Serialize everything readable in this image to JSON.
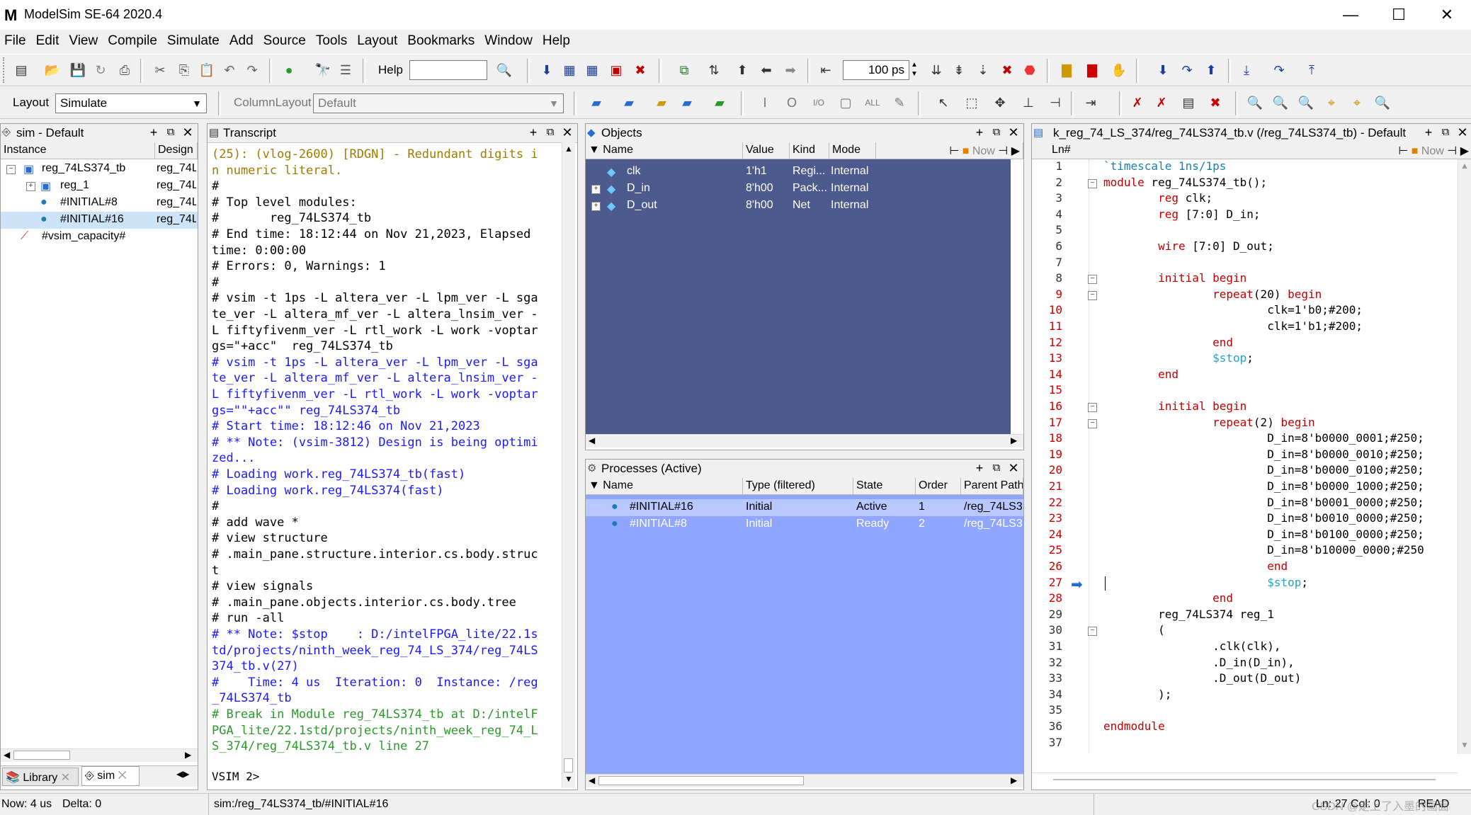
{
  "window": {
    "title": "ModelSim SE-64 2020.4",
    "minimize": "—",
    "maximize": "☐",
    "close": "✕"
  },
  "menu": [
    "File",
    "Edit",
    "View",
    "Compile",
    "Simulate",
    "Add",
    "Source",
    "Tools",
    "Layout",
    "Bookmarks",
    "Window",
    "Help"
  ],
  "toolbar": {
    "help_label": "Help",
    "help_value": "",
    "time_value": "100 ps",
    "layout_label": "Layout",
    "layout_value": "Simulate",
    "columnlayout_label": "ColumnLayout",
    "columnlayout_value": "Default"
  },
  "sim_pane": {
    "title": "sim - Default",
    "columns": [
      "Instance",
      "Design u"
    ],
    "rows": [
      {
        "instance": "reg_74LS374_tb",
        "design": "reg_74L",
        "expander": "−",
        "icon": "module-icon"
      },
      {
        "instance": "reg_1",
        "design": "reg_74L",
        "expander": "+",
        "icon": "module-icon"
      },
      {
        "instance": "#INITIAL#8",
        "design": "reg_74L",
        "expander": "",
        "icon": "process-icon"
      },
      {
        "instance": "#INITIAL#16",
        "design": "reg_74L",
        "expander": "",
        "icon": "process-icon"
      },
      {
        "instance": "#vsim_capacity#",
        "design": "",
        "expander": "",
        "icon": "capacity-icon"
      }
    ],
    "tabs": [
      {
        "label": "Library"
      },
      {
        "label": "sim"
      }
    ]
  },
  "transcript": {
    "title": "Transcript",
    "lines": [
      {
        "t": "(25): (vlog-2600) [RDGN] - Redundant digits i",
        "c": "olive"
      },
      {
        "t": "n numeric literal.",
        "c": "olive"
      },
      {
        "t": "#",
        "c": "black"
      },
      {
        "t": "# Top level modules:",
        "c": "black"
      },
      {
        "t": "#       reg_74LS374_tb",
        "c": "black"
      },
      {
        "t": "# End time: 18:12:44 on Nov 21,2023, Elapsed",
        "c": "black"
      },
      {
        "t": "time: 0:00:00",
        "c": "black"
      },
      {
        "t": "# Errors: 0, Warnings: 1",
        "c": "black"
      },
      {
        "t": "#",
        "c": "black"
      },
      {
        "t": "# vsim -t 1ps -L altera_ver -L lpm_ver -L sga",
        "c": "black"
      },
      {
        "t": "te_ver -L altera_mf_ver -L altera_lnsim_ver -",
        "c": "black"
      },
      {
        "t": "L fiftyfivenm_ver -L rtl_work -L work -voptar",
        "c": "black"
      },
      {
        "t": "gs=\"+acc\"  reg_74LS374_tb",
        "c": "black"
      },
      {
        "t": "# vsim -t 1ps -L altera_ver -L lpm_ver -L sga",
        "c": "blue"
      },
      {
        "t": "te_ver -L altera_mf_ver -L altera_lnsim_ver -",
        "c": "blue"
      },
      {
        "t": "L fiftyfivenm_ver -L rtl_work -L work -voptar",
        "c": "blue"
      },
      {
        "t": "gs=\"\"+acc\"\" reg_74LS374_tb",
        "c": "blue"
      },
      {
        "t": "# Start time: 18:12:46 on Nov 21,2023",
        "c": "blue"
      },
      {
        "t": "# ** Note: (vsim-3812) Design is being optimi",
        "c": "blue"
      },
      {
        "t": "zed...",
        "c": "blue"
      },
      {
        "t": "# Loading work.reg_74LS374_tb(fast)",
        "c": "blue"
      },
      {
        "t": "# Loading work.reg_74LS374(fast)",
        "c": "blue"
      },
      {
        "t": "#",
        "c": "black"
      },
      {
        "t": "# add wave *",
        "c": "black"
      },
      {
        "t": "# view structure",
        "c": "black"
      },
      {
        "t": "# .main_pane.structure.interior.cs.body.struc",
        "c": "black"
      },
      {
        "t": "t",
        "c": "black"
      },
      {
        "t": "# view signals",
        "c": "black"
      },
      {
        "t": "# .main_pane.objects.interior.cs.body.tree",
        "c": "black"
      },
      {
        "t": "# run -all",
        "c": "black"
      },
      {
        "t": "# ** Note: $stop    : D:/intelFPGA_lite/22.1s",
        "c": "blue"
      },
      {
        "t": "td/projects/ninth_week_reg_74_LS_374/reg_74LS",
        "c": "blue"
      },
      {
        "t": "374_tb.v(27)",
        "c": "blue"
      },
      {
        "t": "#    Time: 4 us  Iteration: 0  Instance: /reg",
        "c": "blue"
      },
      {
        "t": "_74LS374_tb",
        "c": "blue"
      },
      {
        "t": "# Break in Module reg_74LS374_tb at D:/intelF",
        "c": "green"
      },
      {
        "t": "PGA_lite/22.1std/projects/ninth_week_reg_74_L",
        "c": "green"
      },
      {
        "t": "S_374/reg_74LS374_tb.v line 27",
        "c": "green"
      }
    ],
    "prompt": "VSIM 2>"
  },
  "objects": {
    "title": "Objects",
    "columns": [
      "Name",
      "Value",
      "Kind",
      "Mode"
    ],
    "now_label": "Now",
    "rows": [
      {
        "name": "clk",
        "value": "1'h1",
        "kind": "Regi...",
        "mode": "Internal",
        "expander": ""
      },
      {
        "name": "D_in",
        "value": "8'h00",
        "kind": "Pack...",
        "mode": "Internal",
        "expander": "+"
      },
      {
        "name": "D_out",
        "value": "8'h00",
        "kind": "Net",
        "mode": "Internal",
        "expander": "+"
      }
    ]
  },
  "processes": {
    "title": "Processes (Active)",
    "columns": [
      "Name",
      "Type (filtered)",
      "State",
      "Order",
      "Parent Path"
    ],
    "rows": [
      {
        "name": "#INITIAL#16",
        "type": "Initial",
        "state": "Active",
        "order": "1",
        "parent": "/reg_74LS3"
      },
      {
        "name": "#INITIAL#8",
        "type": "Initial",
        "state": "Ready",
        "order": "2",
        "parent": "/reg_74LS3"
      }
    ]
  },
  "source": {
    "title": "k_reg_74_LS_374/reg_74LS374_tb.v (/reg_74LS374_tb) - Default",
    "ln_header": "Ln#",
    "now_label": "Now",
    "current_line": 27,
    "lines": [
      {
        "n": "1",
        "t": "`timescale 1ns/1ps",
        "fold": ""
      },
      {
        "n": "2",
        "t": "module reg_74LS374_tb();",
        "fold": "−"
      },
      {
        "n": "3",
        "t": "        reg clk;",
        "fold": ""
      },
      {
        "n": "4",
        "t": "        reg [7:0] D_in;",
        "fold": ""
      },
      {
        "n": "5",
        "t": "",
        "fold": ""
      },
      {
        "n": "6",
        "t": "        wire [7:0] D_out;",
        "fold": ""
      },
      {
        "n": "7",
        "t": "",
        "fold": ""
      },
      {
        "n": "8",
        "t": "        initial begin",
        "fold": "−"
      },
      {
        "n": "9",
        "t": "                repeat(20) begin",
        "fold": "−"
      },
      {
        "n": "10",
        "t": "                        clk=1'b0;#200;",
        "fold": ""
      },
      {
        "n": "11",
        "t": "                        clk=1'b1;#200;",
        "fold": ""
      },
      {
        "n": "12",
        "t": "                end",
        "fold": ""
      },
      {
        "n": "13",
        "t": "                $stop;",
        "fold": ""
      },
      {
        "n": "14",
        "t": "        end",
        "fold": ""
      },
      {
        "n": "15",
        "t": "",
        "fold": ""
      },
      {
        "n": "16",
        "t": "        initial begin",
        "fold": "−"
      },
      {
        "n": "17",
        "t": "                repeat(2) begin",
        "fold": "−"
      },
      {
        "n": "18",
        "t": "                        D_in=8'b0000_0001;#250;",
        "fold": ""
      },
      {
        "n": "19",
        "t": "                        D_in=8'b0000_0010;#250;",
        "fold": ""
      },
      {
        "n": "20",
        "t": "                        D_in=8'b0000_0100;#250;",
        "fold": ""
      },
      {
        "n": "21",
        "t": "                        D_in=8'b0000_1000;#250;",
        "fold": ""
      },
      {
        "n": "22",
        "t": "                        D_in=8'b0001_0000;#250;",
        "fold": ""
      },
      {
        "n": "23",
        "t": "                        D_in=8'b0010_0000;#250;",
        "fold": ""
      },
      {
        "n": "24",
        "t": "                        D_in=8'b0100_0000;#250;",
        "fold": ""
      },
      {
        "n": "25",
        "t": "                        D_in=8'b10000_0000;#250",
        "fold": ""
      },
      {
        "n": "26",
        "t": "                        end",
        "fold": ""
      },
      {
        "n": "27",
        "t": "                        $stop;",
        "fold": ""
      },
      {
        "n": "28",
        "t": "                end",
        "fold": ""
      },
      {
        "n": "29",
        "t": "        reg_74LS374 reg_1",
        "fold": ""
      },
      {
        "n": "30",
        "t": "        (",
        "fold": "−"
      },
      {
        "n": "31",
        "t": "                .clk(clk),",
        "fold": ""
      },
      {
        "n": "32",
        "t": "                .D_in(D_in),",
        "fold": ""
      },
      {
        "n": "33",
        "t": "                .D_out(D_out)",
        "fold": ""
      },
      {
        "n": "34",
        "t": "        );",
        "fold": ""
      },
      {
        "n": "35",
        "t": "",
        "fold": ""
      },
      {
        "n": "36",
        "t": "endmodule",
        "fold": ""
      },
      {
        "n": "37",
        "t": "",
        "fold": ""
      }
    ]
  },
  "status": {
    "now": "Now: 4 us",
    "delta": "Delta: 0",
    "path": "sim:/reg_74LS374_tb/#INITIAL#16",
    "ln": "Ln:",
    "ln_value": "27",
    "col": "Col:",
    "col_value": "0",
    "mode": "READ",
    "watermark": "CSDN @走上了入墨的画面"
  },
  "colors": {
    "objects_bg": "#4d5a8e",
    "processes_bg": "#8fa5ff",
    "process_selected": "#b8c8ff",
    "selection_row": "#cde3f7",
    "keyword": "#c00000",
    "system_task": "#1fa3c8"
  }
}
